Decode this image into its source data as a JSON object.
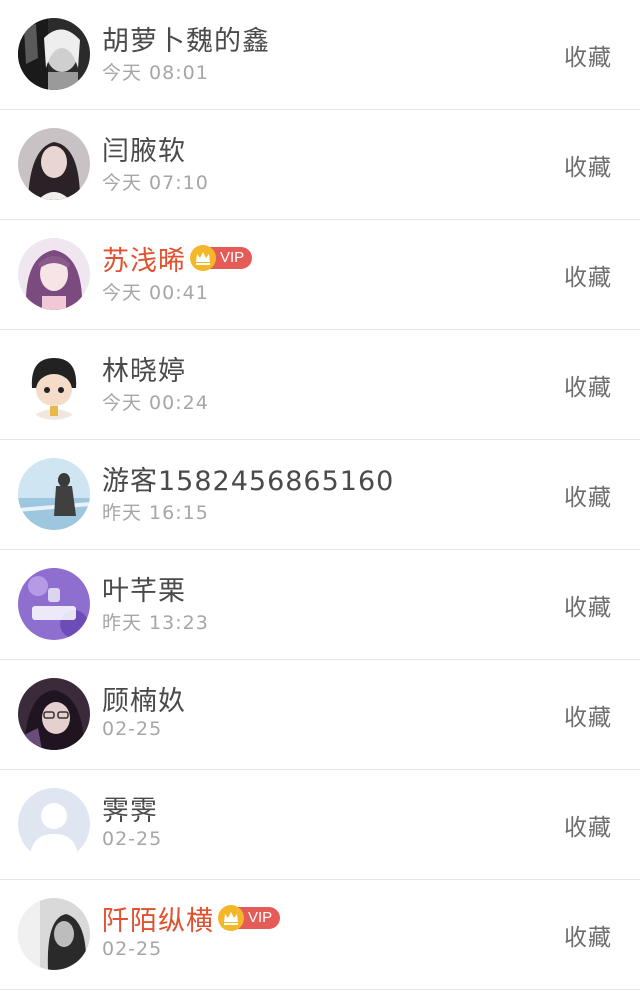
{
  "items": [
    {
      "name": "胡萝卜魏的鑫",
      "time": "今天 08:01",
      "vip": false,
      "vip_label": "",
      "action": "收藏",
      "avatar": "avatar-bw-portrait"
    },
    {
      "name": "闫腋软",
      "time": "今天 07:10",
      "vip": false,
      "vip_label": "",
      "action": "收藏",
      "avatar": "avatar-girl-portrait"
    },
    {
      "name": "苏浅晞",
      "time": "今天 00:41",
      "vip": true,
      "vip_label": "VIP",
      "action": "收藏",
      "avatar": "avatar-girl-pink"
    },
    {
      "name": "林晓婷",
      "time": "今天 00:24",
      "vip": false,
      "vip_label": "",
      "action": "收藏",
      "avatar": "avatar-cartoon-boy"
    },
    {
      "name": "游客1582456865160",
      "time": "昨天 16:15",
      "vip": false,
      "vip_label": "",
      "action": "收藏",
      "avatar": "avatar-sea-scene"
    },
    {
      "name": "叶芊栗",
      "time": "昨天 13:23",
      "vip": false,
      "vip_label": "",
      "action": "收藏",
      "avatar": "avatar-purple-logo"
    },
    {
      "name": "顾楠奺",
      "time": "02-25",
      "vip": false,
      "vip_label": "",
      "action": "收藏",
      "avatar": "avatar-girl-glasses"
    },
    {
      "name": "霁霁",
      "time": "02-25",
      "vip": false,
      "vip_label": "",
      "action": "收藏",
      "avatar": "avatar-default-person"
    },
    {
      "name": "阡陌纵横",
      "time": "02-25",
      "vip": true,
      "vip_label": "VIP",
      "action": "收藏",
      "avatar": "avatar-bw-girl"
    }
  ],
  "colors": {
    "vip_name": "#e0522f",
    "vip_tag": "#e55b57",
    "crown": "#f5b72a",
    "name": "#4a4a4a",
    "time": "#a6a6a6",
    "action": "#6e6e6e",
    "divider": "#e6e6e6"
  }
}
